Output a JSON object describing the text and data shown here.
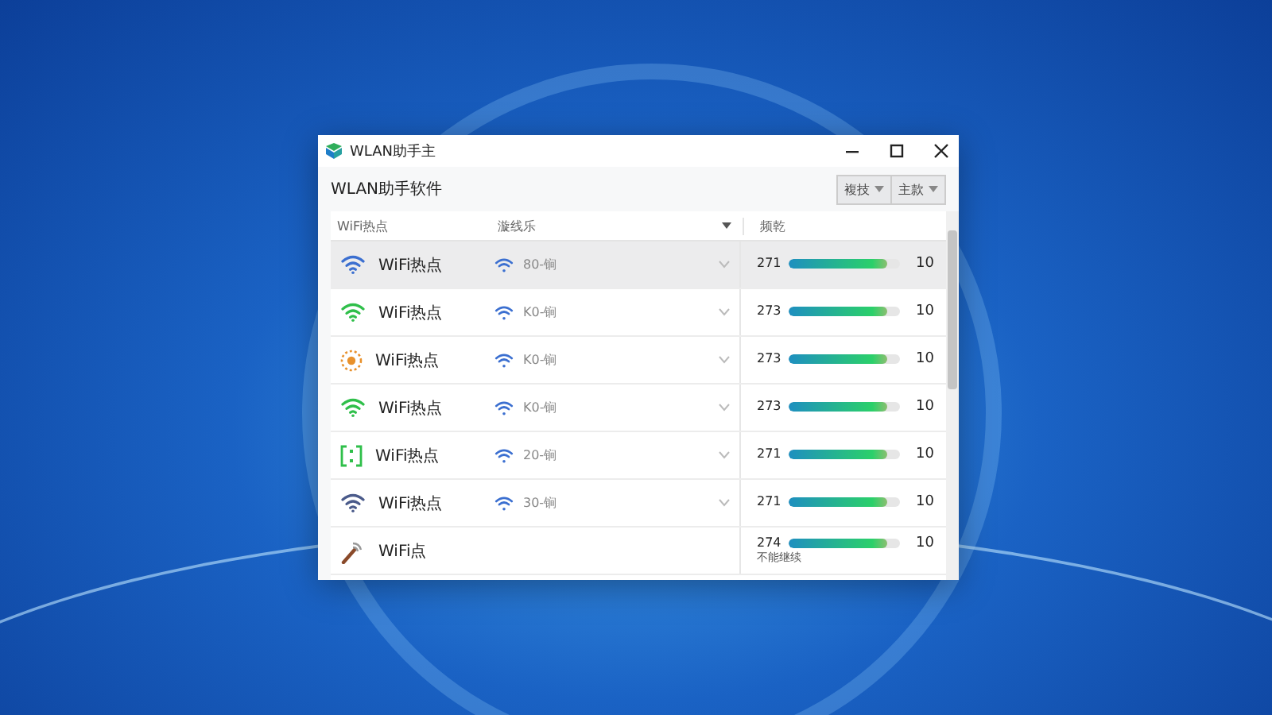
{
  "window": {
    "title": "WLAN助手主"
  },
  "toolbar": {
    "title": "WLAN助手软件",
    "buttons": [
      {
        "label": "複技"
      },
      {
        "label": "主款"
      }
    ]
  },
  "table": {
    "columns": [
      "WiFi热点",
      "漩线乐",
      "频乾"
    ],
    "rows": [
      {
        "kind": "wifi",
        "color": "#3b6fd0",
        "name": "WiFi热点",
        "channel": "80-锏",
        "value": "271",
        "level": 0.88,
        "reading": "10",
        "selected": true
      },
      {
        "kind": "wifi",
        "color": "#2fbf4a",
        "name": "WiFi热点",
        "channel": "K0-锏",
        "value": "273",
        "level": 0.88,
        "reading": "10",
        "selected": false
      },
      {
        "kind": "sun",
        "color": "#e8912c",
        "name": "WiFi热点",
        "channel": "K0-锏",
        "value": "273",
        "level": 0.88,
        "reading": "10",
        "selected": false
      },
      {
        "kind": "wifi",
        "color": "#2fbf4a",
        "name": "WiFi热点",
        "channel": "K0-锏",
        "value": "273",
        "level": 0.88,
        "reading": "10",
        "selected": false
      },
      {
        "kind": "bracket",
        "color": "#2fbf4a",
        "name": "WiFi热点",
        "channel": "20-锏",
        "value": "271",
        "level": 0.88,
        "reading": "10",
        "selected": false
      },
      {
        "kind": "wifi",
        "color": "#4a5a8a",
        "name": "WiFi热点",
        "channel": "30-锏",
        "value": "271",
        "level": 0.88,
        "reading": "10",
        "selected": false
      },
      {
        "kind": "antenna",
        "color": "#8a4a2a",
        "name": "WiFi点",
        "value": "274",
        "level": 0.88,
        "reading": "10",
        "note": "不能继续",
        "selected": false
      }
    ]
  }
}
